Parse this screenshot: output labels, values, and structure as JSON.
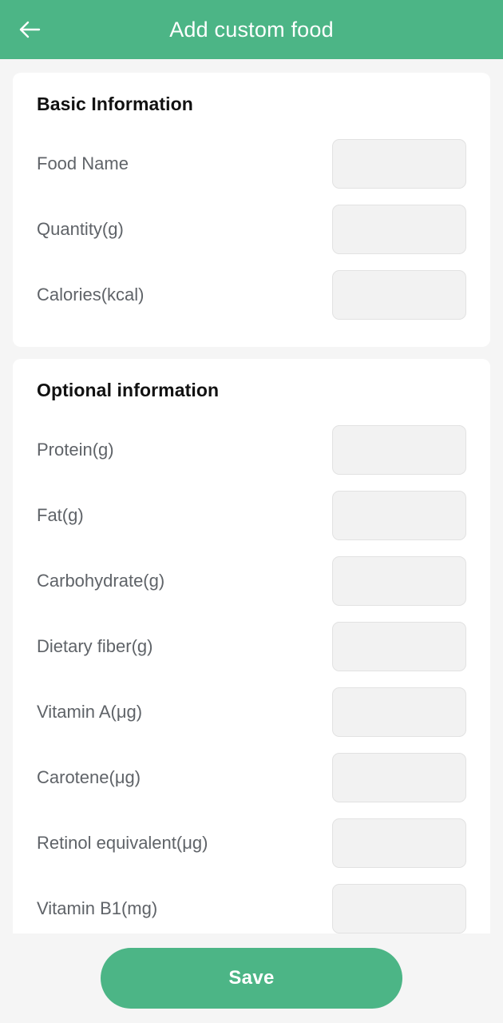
{
  "appbar": {
    "title": "Add custom food",
    "back_icon": "arrow-left-icon",
    "background_color": "#4cb586",
    "title_color": "#ffffff"
  },
  "sections": [
    {
      "title": "Basic Information",
      "fields": [
        {
          "label": "Food Name",
          "value": "",
          "placeholder": ""
        },
        {
          "label": "Quantity(g)",
          "value": "",
          "placeholder": ""
        },
        {
          "label": "Calories(kcal)",
          "value": "",
          "placeholder": ""
        }
      ]
    },
    {
      "title": "Optional information",
      "fields": [
        {
          "label": "Protein(g)",
          "value": "",
          "placeholder": ""
        },
        {
          "label": "Fat(g)",
          "value": "",
          "placeholder": ""
        },
        {
          "label": "Carbohydrate(g)",
          "value": "",
          "placeholder": ""
        },
        {
          "label": "Dietary fiber(g)",
          "value": "",
          "placeholder": ""
        },
        {
          "label": "Vitamin A(μg)",
          "value": "",
          "placeholder": ""
        },
        {
          "label": "Carotene(μg)",
          "value": "",
          "placeholder": ""
        },
        {
          "label": "Retinol equivalent(μg)",
          "value": "",
          "placeholder": ""
        },
        {
          "label": "Vitamin B1(mg)",
          "value": "",
          "placeholder": ""
        }
      ]
    }
  ],
  "bottom_bar": {
    "save_label": "Save",
    "save_color": "#4cb586"
  },
  "theme": {
    "page_background": "#f5f5f5",
    "card_background": "#ffffff",
    "input_background": "#f2f2f2",
    "input_border": "#e2e2e2",
    "label_color": "#5f6368",
    "title_color": "#111111"
  }
}
